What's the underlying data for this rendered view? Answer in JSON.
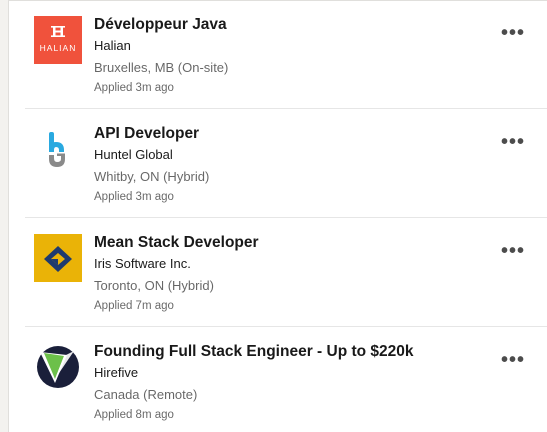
{
  "applied_jobs": [
    {
      "title": "Développeur Java",
      "company": "Halian",
      "location": "Bruxelles, MB (On-site)",
      "applied": "Applied 3m ago",
      "logo_text": "HALIAN",
      "logo_icon": "halian-logo",
      "logo_color": "#f0523c"
    },
    {
      "title": "API Developer",
      "company": "Huntel Global",
      "location": "Whitby, ON (Hybrid)",
      "applied": "Applied 3m ago",
      "logo_icon": "huntel-logo",
      "logo_color": "#29a9e0"
    },
    {
      "title": "Mean Stack Developer",
      "company": "Iris Software Inc.",
      "location": "Toronto, ON (Hybrid)",
      "applied": "Applied 7m ago",
      "logo_icon": "iris-logo",
      "logo_color": "#eab307"
    },
    {
      "title": "Founding Full Stack Engineer - Up to $220k",
      "company": "Hirefive",
      "location": "Canada (Remote)",
      "applied": "Applied 8m ago",
      "logo_icon": "hirefive-logo",
      "logo_color": "#1a1f3a"
    }
  ],
  "more_label": "•••",
  "more_icon": "more-options-icon"
}
